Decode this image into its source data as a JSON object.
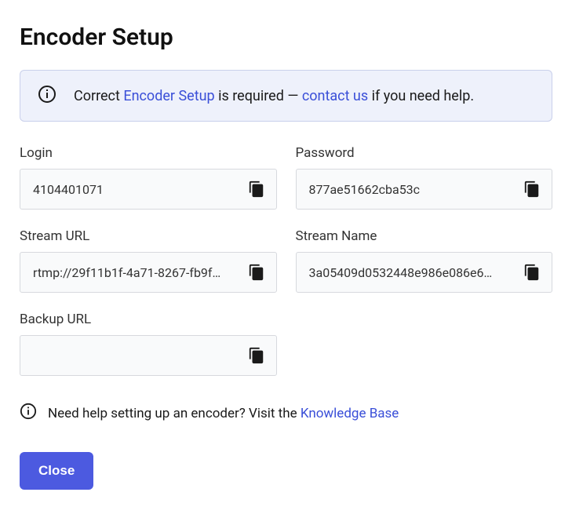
{
  "title": "Encoder Setup",
  "alert": {
    "prefix": "Correct ",
    "link1": "Encoder Setup",
    "mid": " is required — ",
    "link2": "contact us",
    "suffix": " if you need help."
  },
  "fields": {
    "login": {
      "label": "Login",
      "value": "4104401071"
    },
    "password": {
      "label": "Password",
      "value": "877ae51662cba53c"
    },
    "stream_url": {
      "label": "Stream URL",
      "value": "rtmp://29f11b1f-4a71-8267-fb9f…"
    },
    "stream_name": {
      "label": "Stream Name",
      "value": "3a05409d0532448e986e086e6…"
    },
    "backup_url": {
      "label": "Backup URL",
      "value": ""
    }
  },
  "help": {
    "text": "Need help setting up an encoder? Visit the ",
    "link": "Knowledge Base"
  },
  "close_label": "Close"
}
